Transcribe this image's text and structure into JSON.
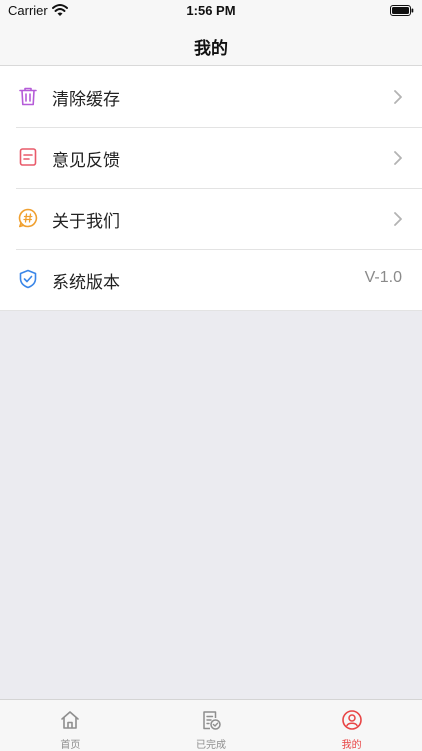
{
  "status_bar": {
    "carrier": "Carrier",
    "time": "1:56 PM"
  },
  "nav": {
    "title": "我的"
  },
  "menu": {
    "items": [
      {
        "label": "清除缓存",
        "icon": "trash-icon",
        "color": "#b55bd8"
      },
      {
        "label": "意见反馈",
        "icon": "feedback-icon",
        "color": "#e95a6a"
      },
      {
        "label": "关于我们",
        "icon": "about-icon",
        "color": "#f0a030"
      },
      {
        "label": "系统版本",
        "icon": "shield-icon",
        "color": "#3a86e8",
        "value": "V-1.0"
      }
    ]
  },
  "tab_bar": {
    "tabs": [
      {
        "label": "首页",
        "icon": "home-icon"
      },
      {
        "label": "已完成",
        "icon": "completed-icon"
      },
      {
        "label": "我的",
        "icon": "profile-icon",
        "active": true
      }
    ],
    "active_color": "#e84545",
    "inactive_color": "#8e8e8e"
  }
}
